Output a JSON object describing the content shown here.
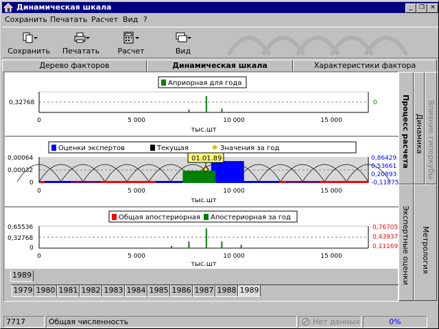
{
  "window": {
    "title": "Динамическая шкала"
  },
  "menu": [
    "Сохранить",
    "Печатать",
    "Расчет",
    "Вид",
    "?"
  ],
  "toolbar": {
    "save": "Сохранить",
    "print": "Печатать",
    "calc": "Расчет",
    "view": "Вид"
  },
  "tabs": [
    "Дерево факторов",
    "Динамическая шкала",
    "Характеристики фактора"
  ],
  "side_tabs": {
    "process": "Процесс расчета",
    "dynamics": "Динамика",
    "hyper": "Влияние гиперкубы",
    "experts": "Экспертные оценки",
    "metrology": "Метрология"
  },
  "panel1": {
    "legend": "Априорная для года",
    "y_ticks": [
      "0,32768"
    ],
    "right_label": "0",
    "x_ticks": [
      "0",
      "5 000",
      "10 000",
      "15 000"
    ],
    "x_label": "тыс.шт"
  },
  "panel2": {
    "legend": [
      "Оценки экспертов",
      "Текущая",
      "Значения за год"
    ],
    "y_ticks": [
      "0,00064",
      "0,00032",
      "0"
    ],
    "right_labels": [
      "0,86429",
      "0,53661",
      "0,20893",
      "-0,11875"
    ],
    "x_ticks": [
      "0",
      "5 000",
      "10 000",
      "15 000"
    ],
    "x_label": "тыс.шт",
    "tooltip": "01.01.89"
  },
  "panel3": {
    "legend": [
      "Общая апостериорная",
      "Апостериорная за год"
    ],
    "y_ticks": [
      "0,65536",
      "0,32768",
      "0"
    ],
    "right_labels": [
      "0,76705",
      "0,43937",
      "0,11169"
    ],
    "x_ticks": [
      "0",
      "5 000",
      "10 000",
      "15 000"
    ],
    "x_label": "тыс.шт"
  },
  "year_single": "1989",
  "years": [
    "1979",
    "1980",
    "1981",
    "1982",
    "1983",
    "1984",
    "1985",
    "1986",
    "1987",
    "1988",
    "1989"
  ],
  "status": {
    "count": "7717",
    "name": "Общая численность",
    "nodata": "Нет данных",
    "percent": "0%"
  },
  "colors": {
    "title_bg": "#000080",
    "blue": "#0000ff",
    "red": "#ff0000",
    "green": "#008000",
    "yellow": "#ffff80"
  },
  "chart_data": [
    {
      "type": "bar",
      "title": "Априорная для года",
      "xlabel": "тыс.шт",
      "xlim": [
        0,
        17000
      ],
      "series": [
        {
          "name": "Априорная для года",
          "x": [
            7700,
            8600,
            9400
          ],
          "values": [
            0.15,
            0.85,
            0.2
          ]
        }
      ]
    },
    {
      "type": "bar",
      "xlabel": "тыс.шт",
      "xlim": [
        0,
        17000
      ],
      "ylim": [
        0,
        0.00064
      ],
      "series": [
        {
          "name": "Оценки экспертов",
          "x": [
            9800
          ],
          "values": [
            0.00064
          ]
        },
        {
          "name": "Текущая",
          "x": [
            7700
          ],
          "values": [
            0.00032
          ]
        }
      ]
    },
    {
      "type": "bar",
      "xlabel": "тыс.шт",
      "xlim": [
        0,
        17000
      ],
      "series": [
        {
          "name": "Апостериорная за год",
          "x": [
            6800,
            7700,
            8600,
            9400,
            10400
          ],
          "values": [
            0.1,
            0.3,
            0.9,
            0.3,
            0.15
          ]
        }
      ]
    }
  ]
}
